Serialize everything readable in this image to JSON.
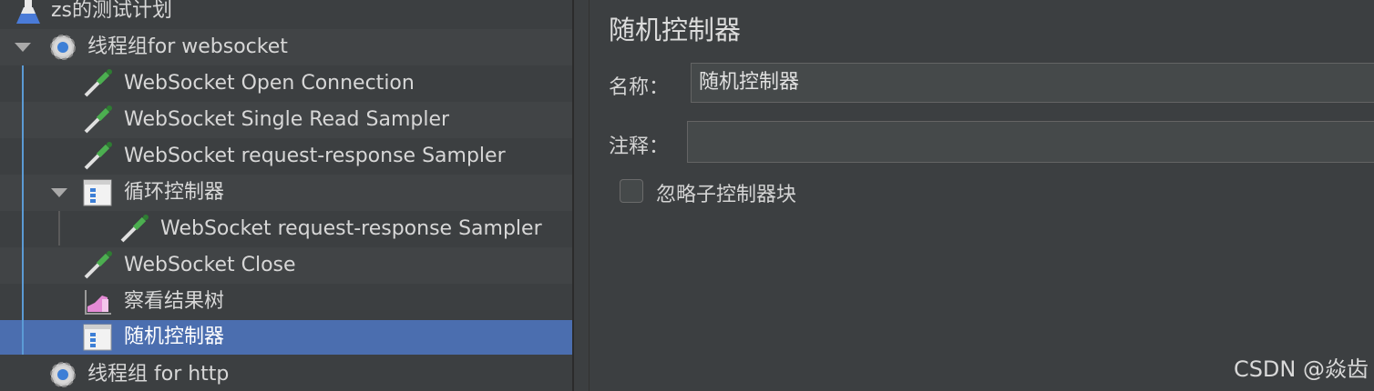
{
  "tree": {
    "items": [
      {
        "label": "zs的测试计划"
      },
      {
        "label": "线程组for websocket"
      },
      {
        "label": "WebSocket Open Connection"
      },
      {
        "label": "WebSocket Single Read Sampler"
      },
      {
        "label": "WebSocket request-response Sampler"
      },
      {
        "label": "循环控制器"
      },
      {
        "label": "WebSocket request-response Sampler"
      },
      {
        "label": "WebSocket Close"
      },
      {
        "label": "察看结果树"
      },
      {
        "label": "随机控制器"
      },
      {
        "label": "线程组 for http"
      }
    ]
  },
  "form": {
    "title": "随机控制器",
    "name_label": "名称：",
    "name_value": "随机控制器",
    "comment_label": "注释：",
    "comment_value": "",
    "checkbox_label": "忽略子控制器块",
    "checkbox_checked": false
  },
  "watermark": "CSDN @焱齿",
  "colors": {
    "background": "#3c3f41",
    "selected_row": "#4b6eaf",
    "tree_guide": "#5b9bd5",
    "text": "#d7d7d7"
  }
}
